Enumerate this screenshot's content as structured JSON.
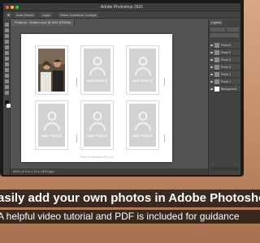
{
  "app": {
    "title": "Adobe Photoshop 2021",
    "traffic_lights": [
      "#ff5f57",
      "#febc2e",
      "#28c840"
    ]
  },
  "options_bar": {
    "items": [
      "Auto-Select:",
      "Layer",
      "Show Transform Controls"
    ]
  },
  "document_tab": "Polaroid - Modern.psd @ 50% (RGB/8)",
  "status_bar": "50% | 8.5 in x 11 in (300 ppi)",
  "frames": [
    {
      "type": "photo"
    },
    {
      "type": "placeholder",
      "label": "ADD PHOTO"
    },
    {
      "type": "placeholder",
      "label": "ADD PHOTO"
    },
    {
      "type": "placeholder",
      "label": "ADD PHOTO"
    },
    {
      "type": "placeholder",
      "label": "ADD PHOTO"
    },
    {
      "type": "placeholder",
      "label": "ADD PHOTO"
    }
  ],
  "labels": {
    "f1": "ADD PHOTO",
    "f2": "ADD PHOTO",
    "f3": "ADD PHOTO",
    "f4": "ADD PHOTO",
    "f5": "ADD PHOTO"
  },
  "document_caption": "Print on cardstock 8.5 x 11",
  "panels": {
    "tab": "Layers",
    "layers": [
      "Photo 6",
      "Photo 5",
      "Photo 4",
      "Photo 3",
      "Photo 2",
      "Photo 1",
      "Background"
    ]
  },
  "banner": {
    "headline": "Easily add your own photos in Adobe Photoshop",
    "subline": "A helpful video tutorial and PDF is included for guidance"
  },
  "colors": {
    "ps_background": "#535353",
    "placeholder_fill": "#d2d2d2",
    "banner_bg": "#120e0c"
  }
}
